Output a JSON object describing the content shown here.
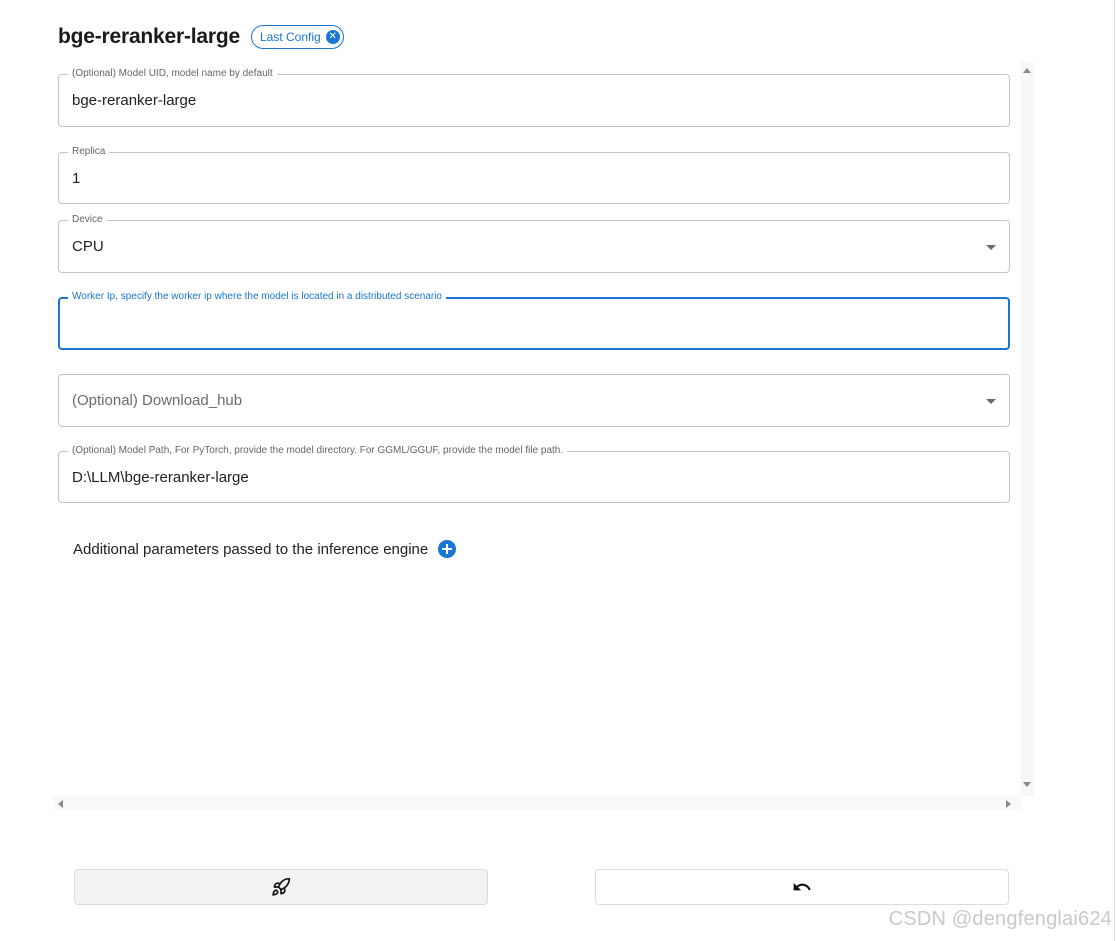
{
  "header": {
    "title": "bge-reranker-large",
    "chip_label": "Last Config",
    "chip_close_icon": "cancel-circle-icon"
  },
  "form": {
    "model_uid": {
      "label": "(Optional) Model UID, model name by default",
      "value": "bge-reranker-large"
    },
    "replica": {
      "label": "Replica",
      "value": "1"
    },
    "device": {
      "label": "Device",
      "value": "CPU",
      "icon": "arrow-drop-down-icon"
    },
    "worker_ip": {
      "label": "Worker Ip, specify the worker ip where the model is located in a distributed scenario",
      "value": ""
    },
    "download_hub": {
      "placeholder": "(Optional) Download_hub",
      "icon": "arrow-drop-down-icon"
    },
    "model_path": {
      "label": "(Optional) Model Path, For PyTorch, provide the model directory. For GGML/GGUF, provide the model file path.",
      "value": "D:\\LLM\\bge-reranker-large"
    }
  },
  "params": {
    "label": "Additional parameters passed to the inference engine",
    "icon": "add-circle-icon"
  },
  "actions": {
    "launch_icon": "rocket-launch-icon",
    "undo_icon": "undo-icon"
  },
  "watermark": "CSDN @dengfenglai624",
  "colors": {
    "accent": "#1976d2",
    "border": "#c4c4c4",
    "launch_bg": "#f2f2f2"
  }
}
